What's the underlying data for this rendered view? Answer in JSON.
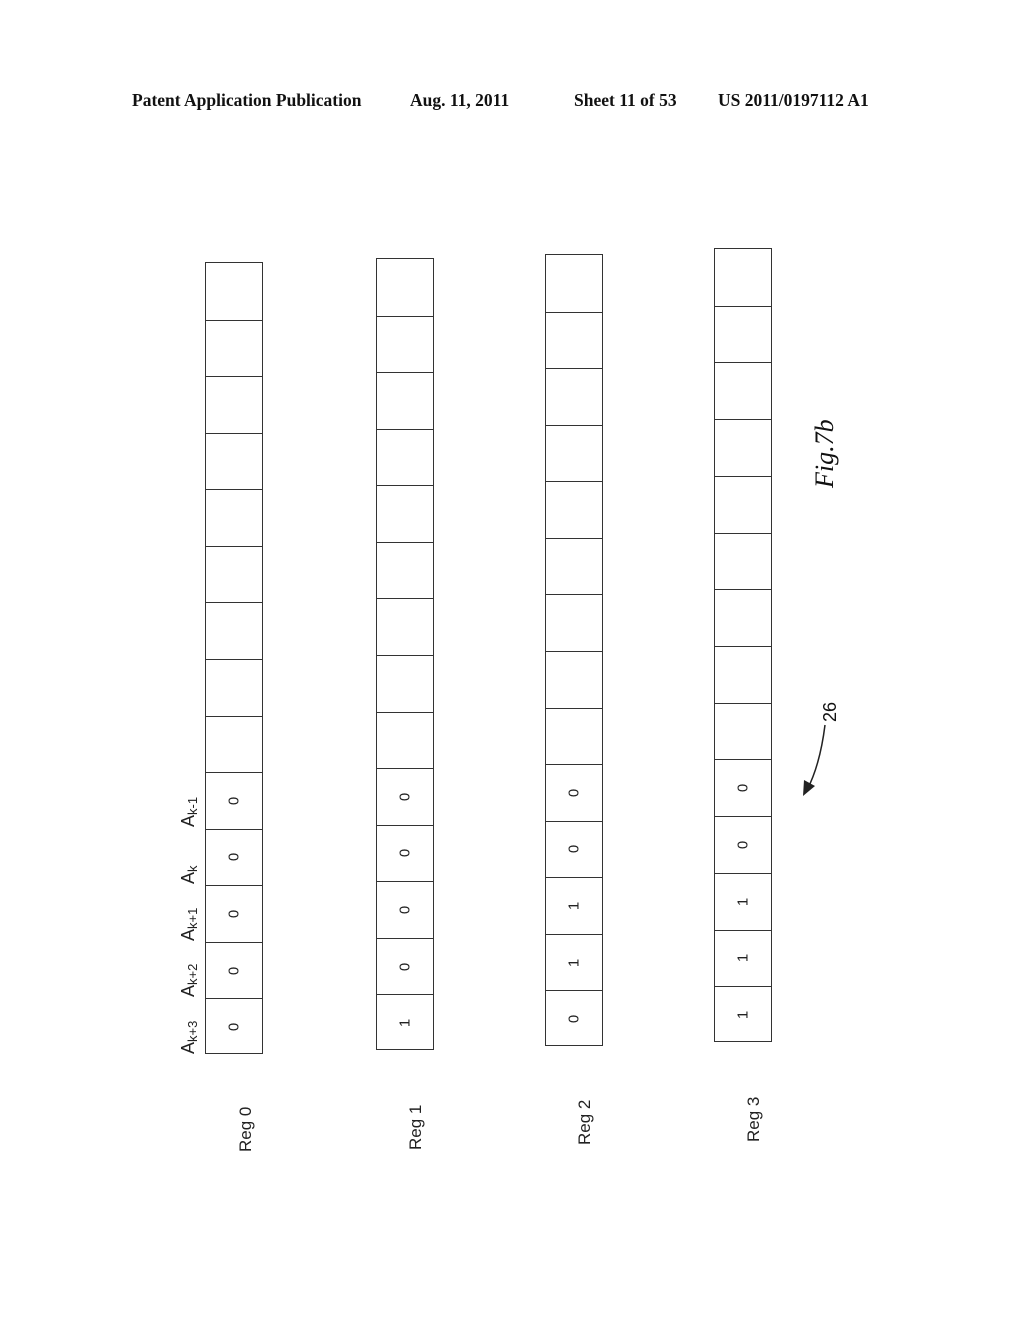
{
  "header": {
    "title": "Patent Application Publication",
    "date": "Aug. 11, 2011",
    "sheet": "Sheet 11 of 53",
    "number": "US 2011/0197112 A1"
  },
  "figure": {
    "label": "Fig.7b",
    "reference_numeral": "26"
  },
  "bit_labels": [
    "A",
    "A",
    "A",
    "A",
    "A"
  ],
  "bit_subscripts": [
    "k+3",
    "k+2",
    "k+1",
    "k",
    "k-1"
  ],
  "registers": [
    {
      "name": "Reg 0",
      "bits": [
        "0",
        "0",
        "0",
        "0",
        "0"
      ],
      "empty_cells": 9
    },
    {
      "name": "Reg 1",
      "bits": [
        "1",
        "0",
        "0",
        "0",
        "0"
      ],
      "empty_cells": 9
    },
    {
      "name": "Reg 2",
      "bits": [
        "0",
        "1",
        "1",
        "0",
        "0"
      ],
      "empty_cells": 9
    },
    {
      "name": "Reg 3",
      "bits": [
        "1",
        "1",
        "1",
        "0",
        "0"
      ],
      "empty_cells": 9
    }
  ]
}
